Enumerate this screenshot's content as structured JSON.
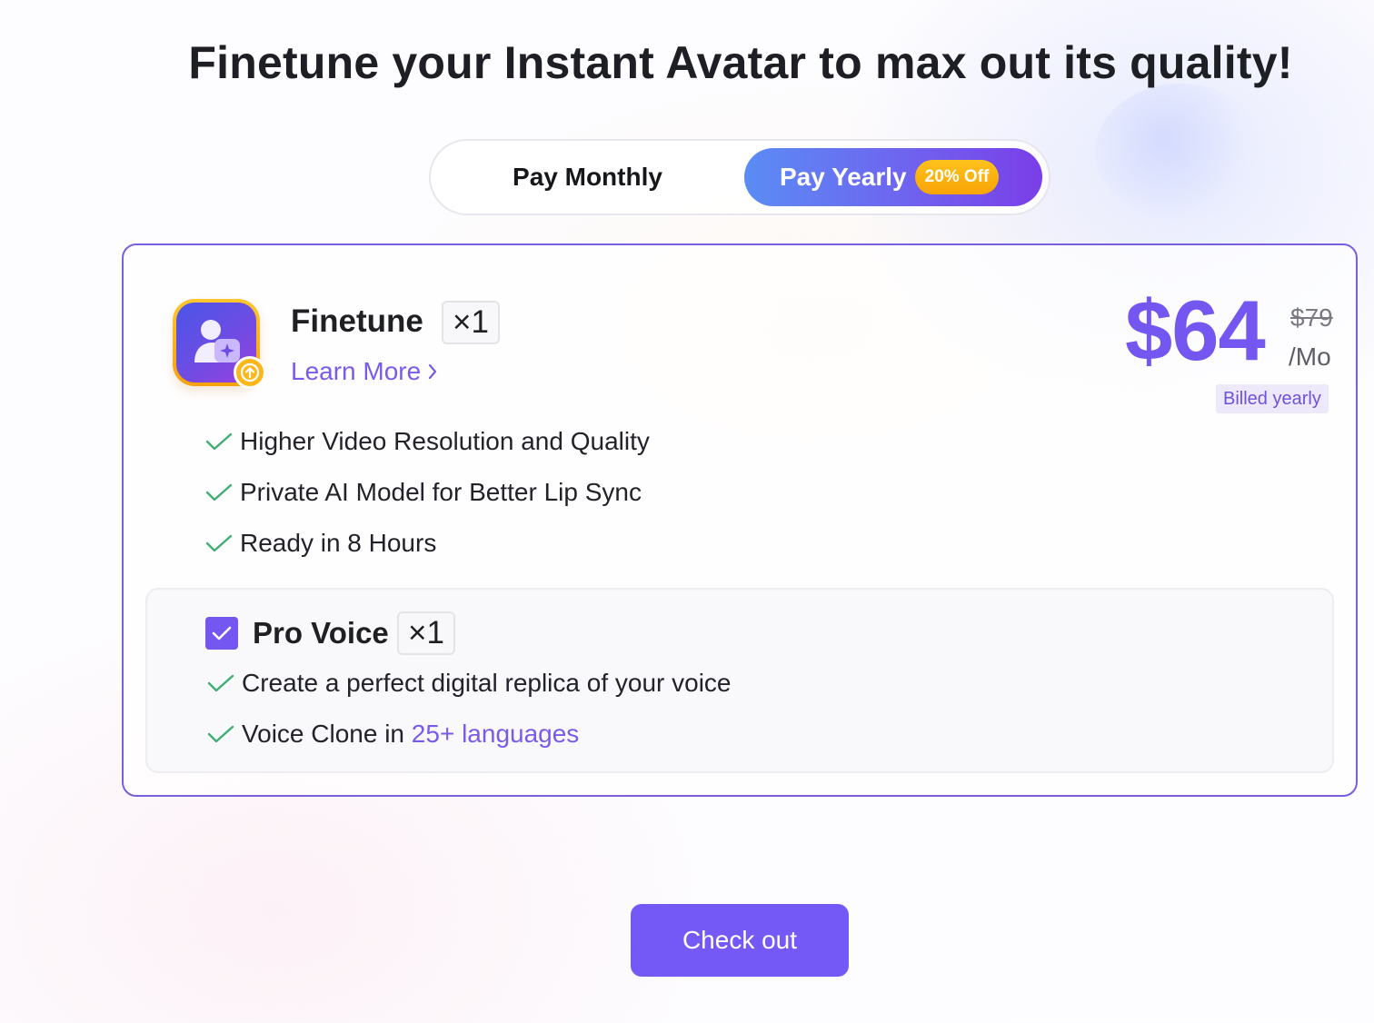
{
  "page": {
    "title": "Finetune your Instant Avatar to max out its quality!"
  },
  "billing_toggle": {
    "monthly_label": "Pay Monthly",
    "yearly_label": "Pay Yearly",
    "yearly_badge": "20% Off",
    "selected": "yearly"
  },
  "product": {
    "icon": "avatar-sparkle-icon",
    "badge_icon": "upgrade-arrow-icon",
    "name": "Finetune",
    "quantity": "×1",
    "learn_more": "Learn More",
    "price": "$64",
    "original_price": "$79",
    "per_period": "/Mo",
    "billed_note": "Billed yearly",
    "features": [
      "Higher Video Resolution and Quality",
      "Private AI Model for Better Lip Sync",
      "Ready in 8 Hours"
    ]
  },
  "addon": {
    "checked": true,
    "name": "Pro Voice",
    "quantity": "×1",
    "features": [
      {
        "text": "Create a perfect digital replica of your voice",
        "highlight": ""
      },
      {
        "text": "Voice Clone in ",
        "highlight": "25+ languages"
      }
    ]
  },
  "checkout": {
    "label": "Check out"
  },
  "colors": {
    "accent": "#7457f0",
    "check_green": "#3fae74",
    "badge_orange": "#fdb61b"
  }
}
